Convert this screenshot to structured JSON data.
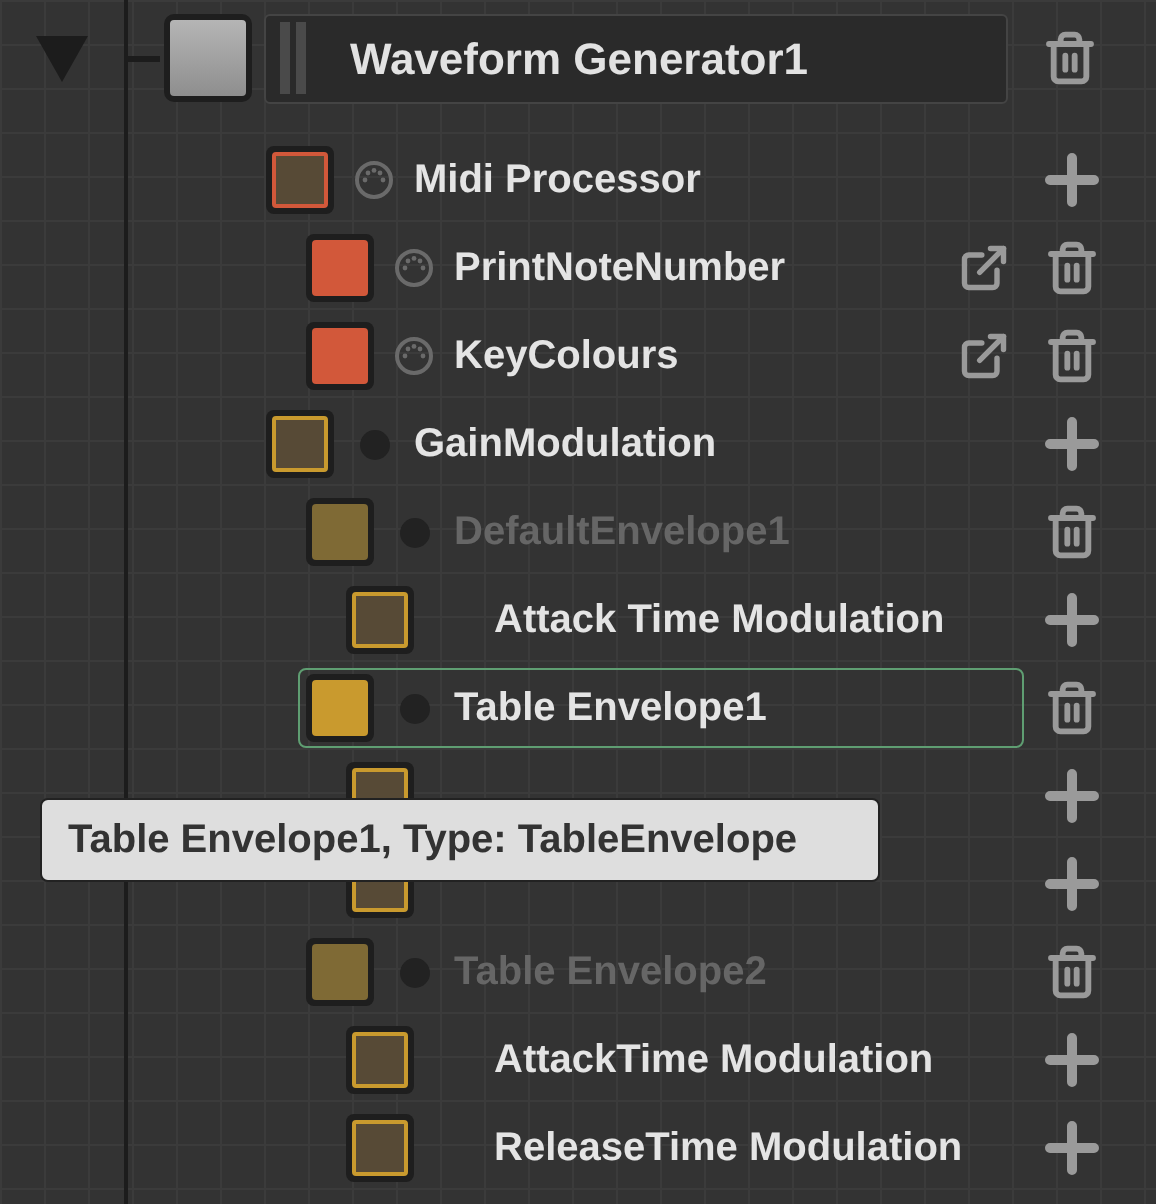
{
  "root": {
    "name": "Waveform Generator1",
    "expanded": true
  },
  "children": [
    {
      "kind": "midi-chain",
      "name": "Midi Processor",
      "color": "#d2583a",
      "bypassed": false,
      "selected": false,
      "children": [
        {
          "kind": "midi-processor",
          "name": "PrintNoteNumber",
          "color": "#d2583a",
          "bypassed": false,
          "selected": false
        },
        {
          "kind": "midi-processor",
          "name": "KeyColours",
          "color": "#d2583a",
          "bypassed": false,
          "selected": false
        }
      ]
    },
    {
      "kind": "modulation-chain",
      "name": "GainModulation",
      "color": "#c99a2e",
      "bypassed": false,
      "selected": false,
      "children": [
        {
          "kind": "modulator",
          "name": "DefaultEnvelope1",
          "color": "#7f6a35",
          "bypassed": true,
          "selected": false,
          "children": [
            {
              "kind": "parameter-chain",
              "name": "Attack Time Modulation",
              "color": "#c99a2e",
              "selected": false
            }
          ]
        },
        {
          "kind": "modulator",
          "name": "Table Envelope1",
          "color": "#c99a2e",
          "bypassed": false,
          "selected": true,
          "children": [
            {
              "kind": "parameter-chain",
              "color": "#c99a2e",
              "selected": false
            },
            {
              "kind": "parameter-chain",
              "color": "#c99a2e",
              "selected": false
            }
          ]
        },
        {
          "kind": "modulator",
          "name": "Table Envelope2",
          "color": "#7f6a35",
          "bypassed": true,
          "selected": false,
          "children": [
            {
              "kind": "parameter-chain",
              "name": "AttackTime Modulation",
              "color": "#c99a2e",
              "selected": false
            },
            {
              "kind": "parameter-chain",
              "name": "ReleaseTime Modulation",
              "color": "#c99a2e",
              "selected": false
            }
          ]
        }
      ]
    }
  ],
  "tooltip": {
    "text": "Table Envelope1, Type: TableEnvelope"
  }
}
